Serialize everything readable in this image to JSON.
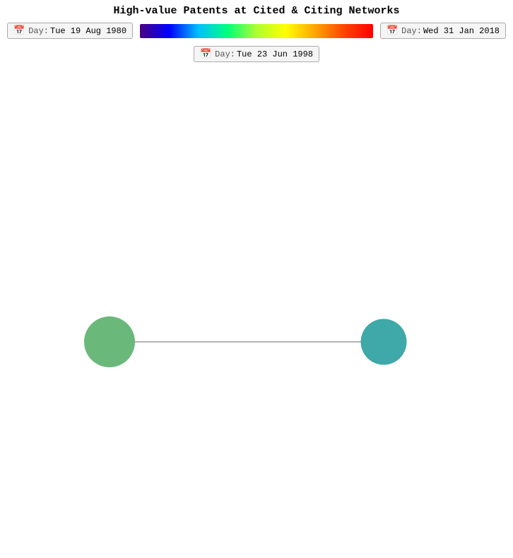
{
  "title": "High-value Patents at Cited & Citing Networks",
  "controls": {
    "date_left_label": "Day:",
    "date_left_value": "Tue 19 Aug 1980",
    "date_right_label": "Day:",
    "date_right_value": "Wed 31 Jan 2018",
    "date_middle_label": "Day:",
    "date_middle_value": "Tue 23 Jun 1998"
  },
  "network": {
    "node_left_color": "#6ab87a",
    "node_right_color": "#3fa8a8",
    "edge_color": "#888888"
  }
}
